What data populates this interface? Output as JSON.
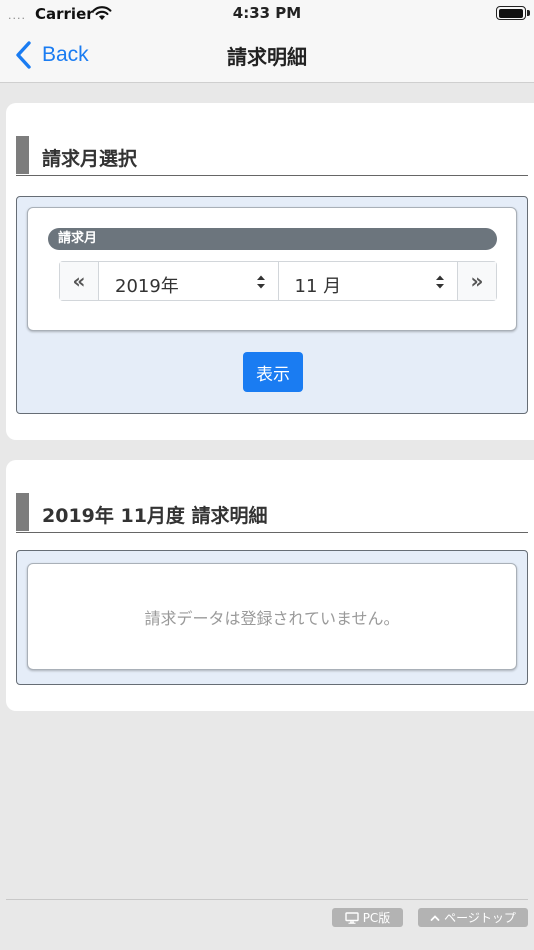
{
  "status_bar": {
    "signal": "....",
    "carrier": "Carrier",
    "time": "4:33 PM"
  },
  "nav": {
    "back_label": "Back",
    "title": "請求明細"
  },
  "month_select": {
    "heading": "請求月選択",
    "field_label": "請求月",
    "prev_symbol": "«",
    "next_symbol": "»",
    "year_value": "2019年",
    "month_value": "11 月",
    "show_button": "表示"
  },
  "statement": {
    "heading": "2019年 11月度 請求明細",
    "empty_message": "請求データは登録されていません。"
  },
  "footer": {
    "pc_label": "PC版",
    "top_label": "ページトップ"
  },
  "colors": {
    "accent": "#1a7cf2",
    "panel_bg": "#e5edf8",
    "label_pill": "#6c757d"
  }
}
